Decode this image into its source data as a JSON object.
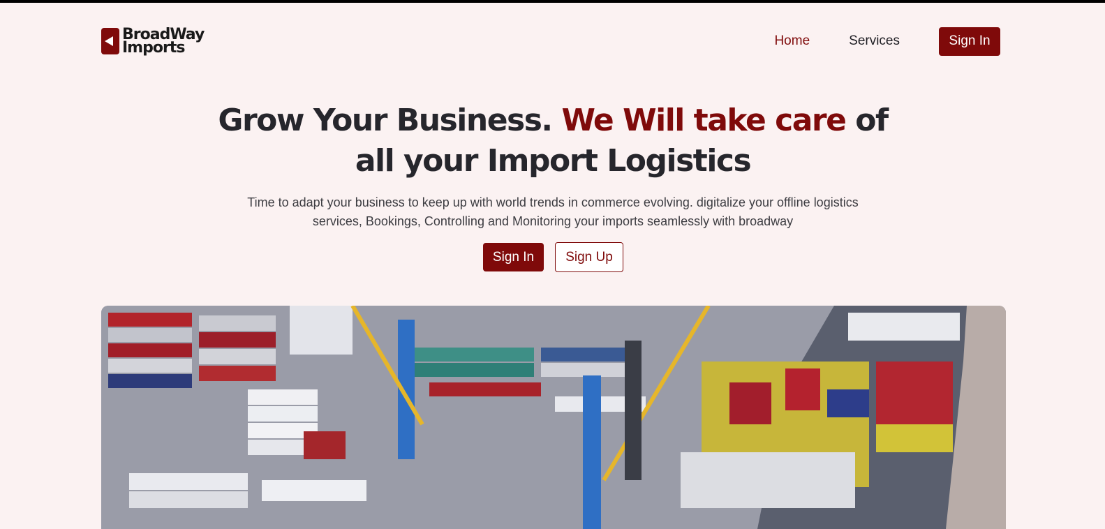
{
  "brand": {
    "line1": "BroadWay",
    "line2": "Imports",
    "logo_icon": "arrow-left-logo-icon",
    "accent_color": "#7f0a0a"
  },
  "nav": {
    "links": [
      {
        "label": "Home",
        "active": true
      },
      {
        "label": "Services",
        "active": false
      }
    ],
    "signin_label": "Sign In"
  },
  "hero": {
    "title_part1": "Grow Your Business. ",
    "title_accent1": "We Will take care",
    "title_part2": " of all your Import Logistics",
    "subtitle": "Time to adapt your business to keep up with world trends in commerce evolving. digitalize your offline logistics services, Bookings, Controlling and Monitoring your imports seamlessly with broadway",
    "signin_label": "Sign In",
    "signup_label": "Sign Up"
  }
}
